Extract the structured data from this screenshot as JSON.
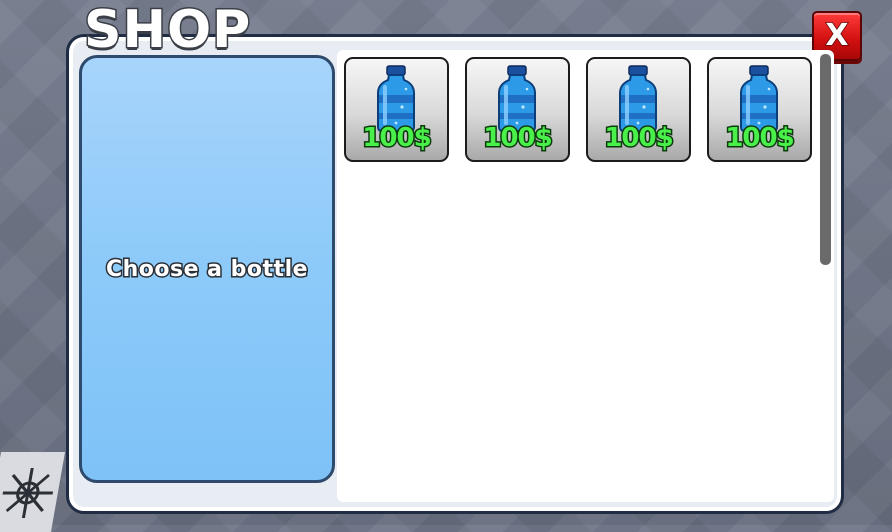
{
  "shop": {
    "title": "SHOP",
    "close_label": "X",
    "prompt": "Choose a bottle",
    "items": [
      {
        "icon": "water-bottle-icon",
        "price": "100$"
      },
      {
        "icon": "water-bottle-icon",
        "price": "100$"
      },
      {
        "icon": "water-bottle-icon",
        "price": "100$"
      },
      {
        "icon": "water-bottle-icon",
        "price": "100$"
      }
    ]
  },
  "colors": {
    "panel_blue": "#8ccaf9",
    "price_green": "#49f04a",
    "close_red": "#d10f0f",
    "border_dark": "#1f2c44"
  }
}
